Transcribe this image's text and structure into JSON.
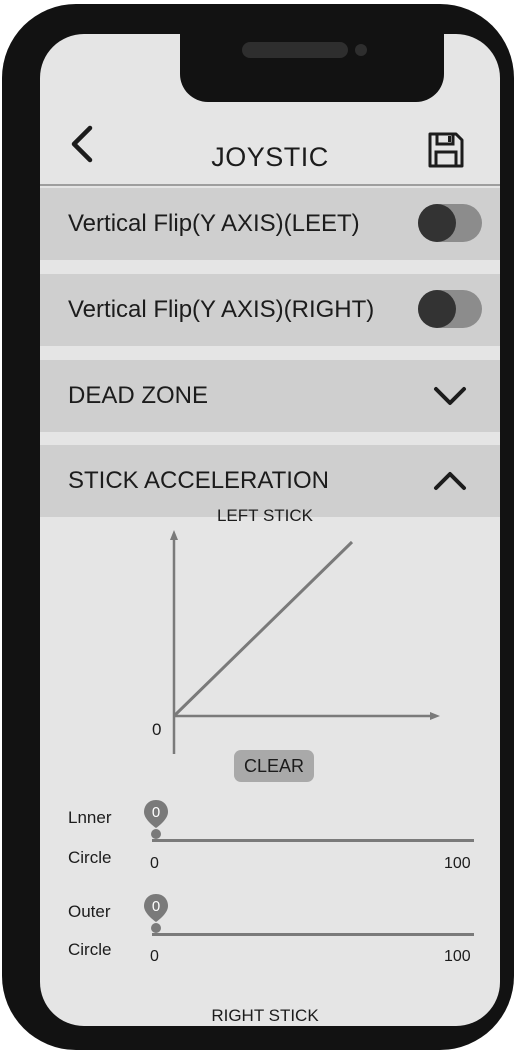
{
  "header": {
    "title": "JOYSTIC"
  },
  "rows": [
    {
      "label": "Vertical Flip(Y AXIS)(LEET)",
      "toggle_on": false
    },
    {
      "label": "Vertical Flip(Y AXIS)(RIGHT)",
      "toggle_on": false
    }
  ],
  "sections": {
    "dead_zone": {
      "label": "DEAD ZONE",
      "expanded": false
    },
    "stick_acceleration": {
      "label": "STICK ACCELERATION",
      "expanded": true
    }
  },
  "left_stick": {
    "title": "LEFT STICK",
    "origin_label": "0",
    "clear_label": "CLEAR"
  },
  "sliders": {
    "inner": {
      "label_line1": "Lnner",
      "label_line2": "Circle",
      "value": "0",
      "min": "0",
      "max": "100"
    },
    "outer": {
      "label_line1": "Outer",
      "label_line2": "Circle",
      "value": "0",
      "min": "0",
      "max": "100"
    }
  },
  "right_stick": {
    "title": "RIGHT STICK"
  },
  "icons": {
    "back": "chevron-left-icon",
    "save": "floppy-disk-icon",
    "dead_zone": "chevron-down-icon",
    "stick_acceleration": "chevron-up-icon"
  },
  "colors": {
    "frame": "#121212",
    "screen": "#e5e5e5",
    "row": "#cfcfcf",
    "accent": "#7a7a7a"
  }
}
